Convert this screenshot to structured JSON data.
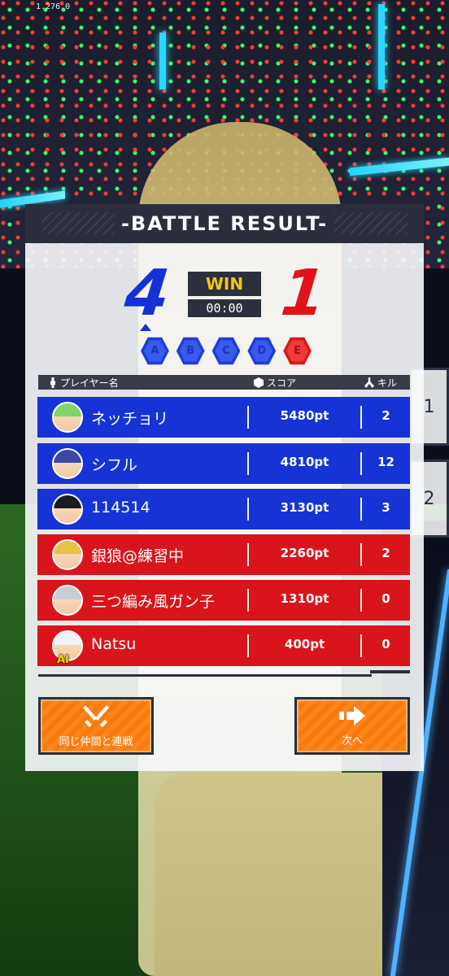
{
  "status": {
    "version": "1.276.0"
  },
  "result": {
    "title": "-BATTLE RESULT-",
    "blue_score": "4",
    "red_score": "1",
    "outcome": "WIN",
    "time": "00:00",
    "points": [
      {
        "label": "A",
        "team": "blue"
      },
      {
        "label": "B",
        "team": "blue"
      },
      {
        "label": "C",
        "team": "blue"
      },
      {
        "label": "D",
        "team": "blue"
      },
      {
        "label": "E",
        "team": "red"
      }
    ]
  },
  "table": {
    "headers": {
      "player": "プレイヤー名",
      "score": "スコア",
      "kill": "キル"
    },
    "rows": [
      {
        "name": "ネッチョリ",
        "score": "5480pt",
        "kills": "2",
        "team": "blue",
        "avatar_icon": "avatar-green-hair"
      },
      {
        "name": "シフル",
        "score": "4810pt",
        "kills": "12",
        "team": "blue",
        "avatar_icon": "avatar-blue-hair"
      },
      {
        "name": "114514",
        "score": "3130pt",
        "kills": "3",
        "team": "blue",
        "avatar_icon": "avatar-black-hair"
      },
      {
        "name": "銀狼@練習中",
        "score": "2260pt",
        "kills": "2",
        "team": "red",
        "avatar_icon": "avatar-blonde-hair"
      },
      {
        "name": "三つ編み風ガン子",
        "score": "1310pt",
        "kills": "0",
        "team": "red",
        "avatar_icon": "avatar-silver-hair"
      },
      {
        "name": "Natsu",
        "score": "400pt",
        "kills": "0",
        "team": "red",
        "avatar_icon": "avatar-white-hair",
        "badge": "AI"
      }
    ]
  },
  "side_tabs": [
    "1",
    "2"
  ],
  "buttons": {
    "rematch_label": "同じ仲間と連戦",
    "next_label": "次へ"
  },
  "colors": {
    "blue_team": "#1633d6",
    "red_team": "#d9141b",
    "accent_button": "#ff8518",
    "win_text": "#f5c518"
  }
}
